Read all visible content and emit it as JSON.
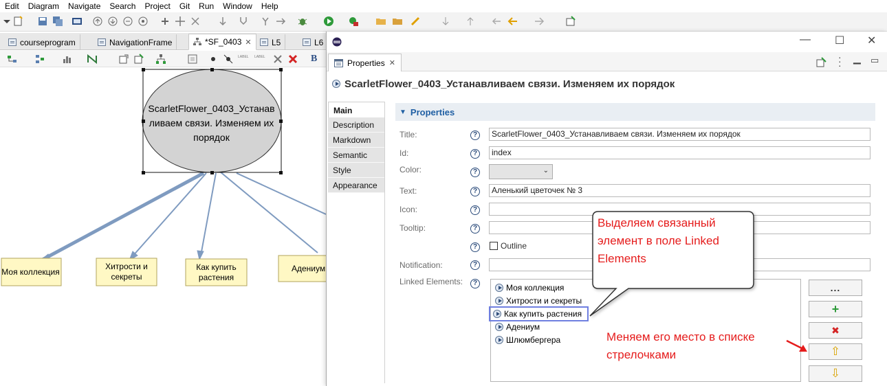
{
  "menu": [
    "Edit",
    "Diagram",
    "Navigate",
    "Search",
    "Project",
    "Git",
    "Run",
    "Window",
    "Help"
  ],
  "editor_tabs": [
    {
      "label": "courseprogram",
      "active": false
    },
    {
      "label": "NavigationFrame",
      "active": false
    },
    {
      "label": "*SF_0403",
      "active": true
    },
    {
      "label": "L5",
      "active": false
    },
    {
      "label": "L6",
      "active": false
    }
  ],
  "editor_toolbar": {
    "label_icon_1": "LABEL",
    "label_icon_2": "LABEL",
    "bold": "B"
  },
  "diagram": {
    "center_node": "ScarletFlower_0403_Устанавливаем связи. Изменяем их порядок",
    "children": [
      "Моя коллекция",
      "Хитрости и секреты",
      "Как купить растения",
      "Адениум"
    ]
  },
  "properties_view": {
    "tab_label": "Properties",
    "header_title": "ScarletFlower_0403_Устанавливаем связи. Изменяем их порядок",
    "vertical_tabs": [
      "Main",
      "Description",
      "Markdown",
      "Semantic",
      "Style",
      "Appearance"
    ],
    "active_tab": "Main",
    "section_title": "Properties",
    "fields": {
      "title": {
        "label": "Title:",
        "value": "ScarletFlower_0403_Устанавливаем связи. Изменяем их порядок"
      },
      "id": {
        "label": "Id:",
        "value": "index"
      },
      "color": {
        "label": "Color:",
        "value": ""
      },
      "text": {
        "label": "Text:",
        "value": "Аленький цветочек № 3"
      },
      "icon": {
        "label": "Icon:",
        "value": ""
      },
      "tooltip": {
        "label": "Tooltip:",
        "value": ""
      },
      "outline": {
        "label": "Outline",
        "checked": false
      },
      "notification": {
        "label": "Notification:",
        "value": ""
      },
      "linked": {
        "label": "Linked Elements:"
      }
    },
    "linked_elements": [
      {
        "label": "Моя коллекция",
        "selected": false
      },
      {
        "label": "Хитрости и секреты",
        "selected": false
      },
      {
        "label": "Как купить растения",
        "selected": true
      },
      {
        "label": "Адениум",
        "selected": false
      },
      {
        "label": "Шлюмбергера",
        "selected": false
      }
    ],
    "list_buttons": {
      "browse": "...",
      "add": "+",
      "remove": "✖",
      "up": "⇧",
      "down": "⇩"
    }
  },
  "callouts": {
    "bubble": [
      "Выделяем связанный",
      "элемент в поле Linked",
      "Elements"
    ],
    "reorder": [
      "Меняем его место в списке",
      "стрелочками"
    ]
  },
  "colors": {
    "node_fill": "#fff8c4",
    "node_border": "#b0a35c",
    "center_fill": "#d3d3d3",
    "connector": "#7f9bc0",
    "accent_red": "#e51c1c",
    "selection": "#6f7fe0",
    "link_blue": "#1f5fa3"
  }
}
